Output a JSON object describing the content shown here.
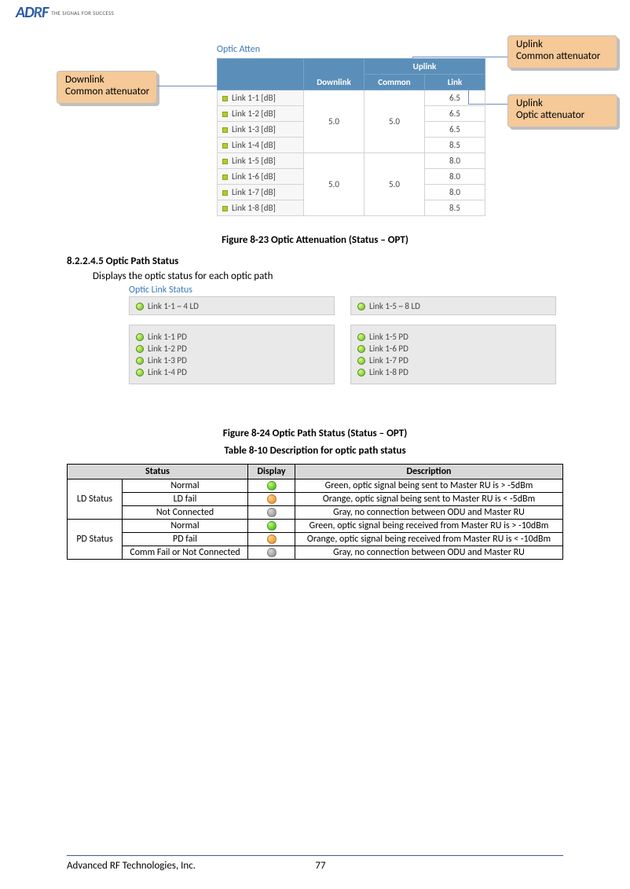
{
  "logo": {
    "tagline": "THE SIGNAL FOR SUCCESS"
  },
  "callouts": {
    "downlink": {
      "l1": "Downlink",
      "l2": "Common attenuator"
    },
    "uplink_common": {
      "l1": "Uplink",
      "l2": "Common attenuator"
    },
    "uplink_optic": {
      "l1": "Uplink",
      "l2": "Optic attenuator"
    }
  },
  "atten": {
    "title": "Optic Atten",
    "hdr_downlink": "Downlink",
    "hdr_uplink": "Uplink",
    "hdr_common": "Common",
    "hdr_link": "Link",
    "groups": [
      {
        "downlink": "5.0",
        "common": "5.0",
        "rows": [
          {
            "label": "Link 1-1 [dB]",
            "link": "6.5"
          },
          {
            "label": "Link 1-2 [dB]",
            "link": "6.5"
          },
          {
            "label": "Link 1-3 [dB]",
            "link": "6.5"
          },
          {
            "label": "Link 1-4 [dB]",
            "link": "8.5"
          }
        ]
      },
      {
        "downlink": "5.0",
        "common": "5.0",
        "rows": [
          {
            "label": "Link 1-5 [dB]",
            "link": "8.0"
          },
          {
            "label": "Link 1-6 [dB]",
            "link": "8.0"
          },
          {
            "label": "Link 1-7 [dB]",
            "link": "8.0"
          },
          {
            "label": "Link 1-8 [dB]",
            "link": "8.5"
          }
        ]
      }
    ]
  },
  "captions": {
    "fig23": "Figure 8-23    Optic Attenuation (Status – OPT)",
    "fig24": "Figure 8-24    Optic Path Status (Status – OPT)",
    "tab10": "Table 8-10     Description for optic path status"
  },
  "section": {
    "num": "8.2.2.4.5    Optic Path Status",
    "desc": "Displays the optic status for each optic path"
  },
  "ols": {
    "title": "Optic Link Status",
    "ld_a": "Link 1-1 ~ 4 LD",
    "ld_b": "Link 1-5 ~ 8 LD",
    "pd_a": [
      "Link 1-1 PD",
      "Link 1-2 PD",
      "Link 1-3 PD",
      "Link 1-4 PD"
    ],
    "pd_b": [
      "Link 1-5 PD",
      "Link 1-6 PD",
      "Link 1-7 PD",
      "Link 1-8 PD"
    ]
  },
  "status_table": {
    "hdr_status": "Status",
    "hdr_display": "Display",
    "hdr_desc": "Description",
    "ld_label": "LD Status",
    "pd_label": "PD Status",
    "ld": [
      {
        "s": "Normal",
        "c": "green",
        "d": "Green, optic signal being sent to Master RU is > -5dBm"
      },
      {
        "s": "LD fail",
        "c": "orange",
        "d": "Orange, optic signal being sent to Master RU is < -5dBm"
      },
      {
        "s": "Not Connected",
        "c": "gray",
        "d": "Gray, no connection between ODU and Master RU"
      }
    ],
    "pd": [
      {
        "s": "Normal",
        "c": "green",
        "d": "Green, optic signal being received from Master RU is > -10dBm"
      },
      {
        "s": "PD fail",
        "c": "orange",
        "d": "Orange, optic signal being received from Master RU is < -10dBm"
      },
      {
        "s": "Comm Fail or Not Connected",
        "c": "gray",
        "d": "Gray, no connection between ODU and Master RU"
      }
    ]
  },
  "footer": {
    "company": "Advanced RF Technologies, Inc.",
    "page": "77"
  }
}
